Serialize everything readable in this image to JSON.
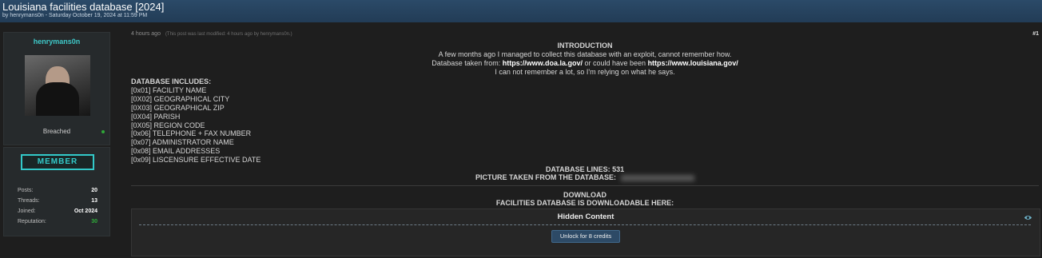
{
  "thread": {
    "title": "Louisiana facilities database [2024]",
    "byline": "by henrymans0n - Saturday October 19, 2024 at 11:59 PM"
  },
  "author": {
    "username": "henrymans0n",
    "status": "Breached",
    "rank": "MEMBER",
    "stats": [
      {
        "label": "Posts:",
        "value": "20"
      },
      {
        "label": "Threads:",
        "value": "13"
      },
      {
        "label": "Joined:",
        "value": "Oct 2024"
      },
      {
        "label": "Reputation:",
        "value": "30"
      }
    ]
  },
  "post": {
    "time": "4 hours ago",
    "edit_note": "(This post was last modified: 4 hours ago by henrymans0n.)",
    "number": "#1",
    "intro_heading": "INTRODUCTION",
    "intro_line1": "A few months ago I managed to collect this database with an exploit, cannot remember how.",
    "intro_line2_prefix": "Database taken from:",
    "intro_link1": "https://www.doa.la.gov/",
    "intro_line2_mid": "or could have been",
    "intro_link2": "https://www.louisiana.gov/",
    "intro_line3": "I can not remember a lot, so I'm relying on what he says.",
    "includes_heading": "DATABASE INCLUDES:",
    "includes": [
      "[0x01] FACILITY NAME",
      "[0X02] GEOGRAPHICAL CITY",
      "[0X03] GEOGRAPHICAL ZIP",
      "[0X04] PARISH",
      "[0X05] REGION CODE",
      "[0x06] TELEPHONE + FAX NUMBER",
      "[0x07] ADMINISTRATOR NAME",
      "[0x08] EMAIL ADDRESSES",
      "[0x09] LISCENSURE EFFECTIVE DATE"
    ],
    "lines": "DATABASE LINES: 531",
    "picture": "PICTURE TAKEN FROM THE DATABASE:",
    "download": "DOWNLOAD",
    "downloadable": "FACILITIES DATABASE IS DOWNLOADABLE HERE:",
    "hidden_title": "Hidden Content",
    "unlock_label": "Unlock for 8 credits"
  },
  "colors": {
    "accent": "#3ec8c8",
    "header": "#2b4a68",
    "reputation": "#2fae3a"
  }
}
